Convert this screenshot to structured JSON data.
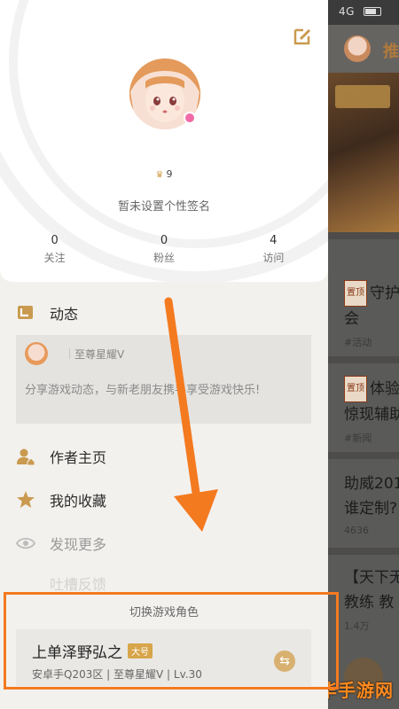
{
  "status_bar": {
    "network": "4G"
  },
  "background_feed": {
    "tab_label": "推",
    "items": [
      {
        "tag": "置顶",
        "line1": "守护",
        "line2": "会",
        "meta": "#活动"
      },
      {
        "tag": "置顶",
        "line1": "体验",
        "line2": "惊现辅助",
        "meta": "#新闻"
      },
      {
        "line1": "助威201",
        "line2": "谁定制?",
        "meta": "4636"
      },
      {
        "line1": "【天下无",
        "line2": "教练 教",
        "meta": "1.4万"
      }
    ],
    "watermark": "京华手游网"
  },
  "profile": {
    "level": "9",
    "signature": "暂未设置个性签名",
    "stats": [
      {
        "value": "0",
        "label": "关注"
      },
      {
        "value": "0",
        "label": "粉丝"
      },
      {
        "value": "4",
        "label": "访问"
      }
    ]
  },
  "menu": {
    "dynamics_label": "动态",
    "feed_card": {
      "rank": "至尊星耀V",
      "description": "分享游戏动态，与新老朋友携手享受游戏快乐!"
    },
    "author_home_label": "作者主页",
    "favorites_label": "我的收藏",
    "discover_more_label": "发现更多",
    "hidden_item_label": "吐槽反馈"
  },
  "role_switch": {
    "title": "切换游戏角色",
    "role_name": "上单泽野弘之",
    "role_badge": "大号",
    "role_info": "安卓手Q203区 | 至尊星耀V | Lv.30"
  },
  "colors": {
    "accent": "#d4a24e",
    "highlight_box": "#f47a20",
    "arrow": "#f47a20"
  }
}
